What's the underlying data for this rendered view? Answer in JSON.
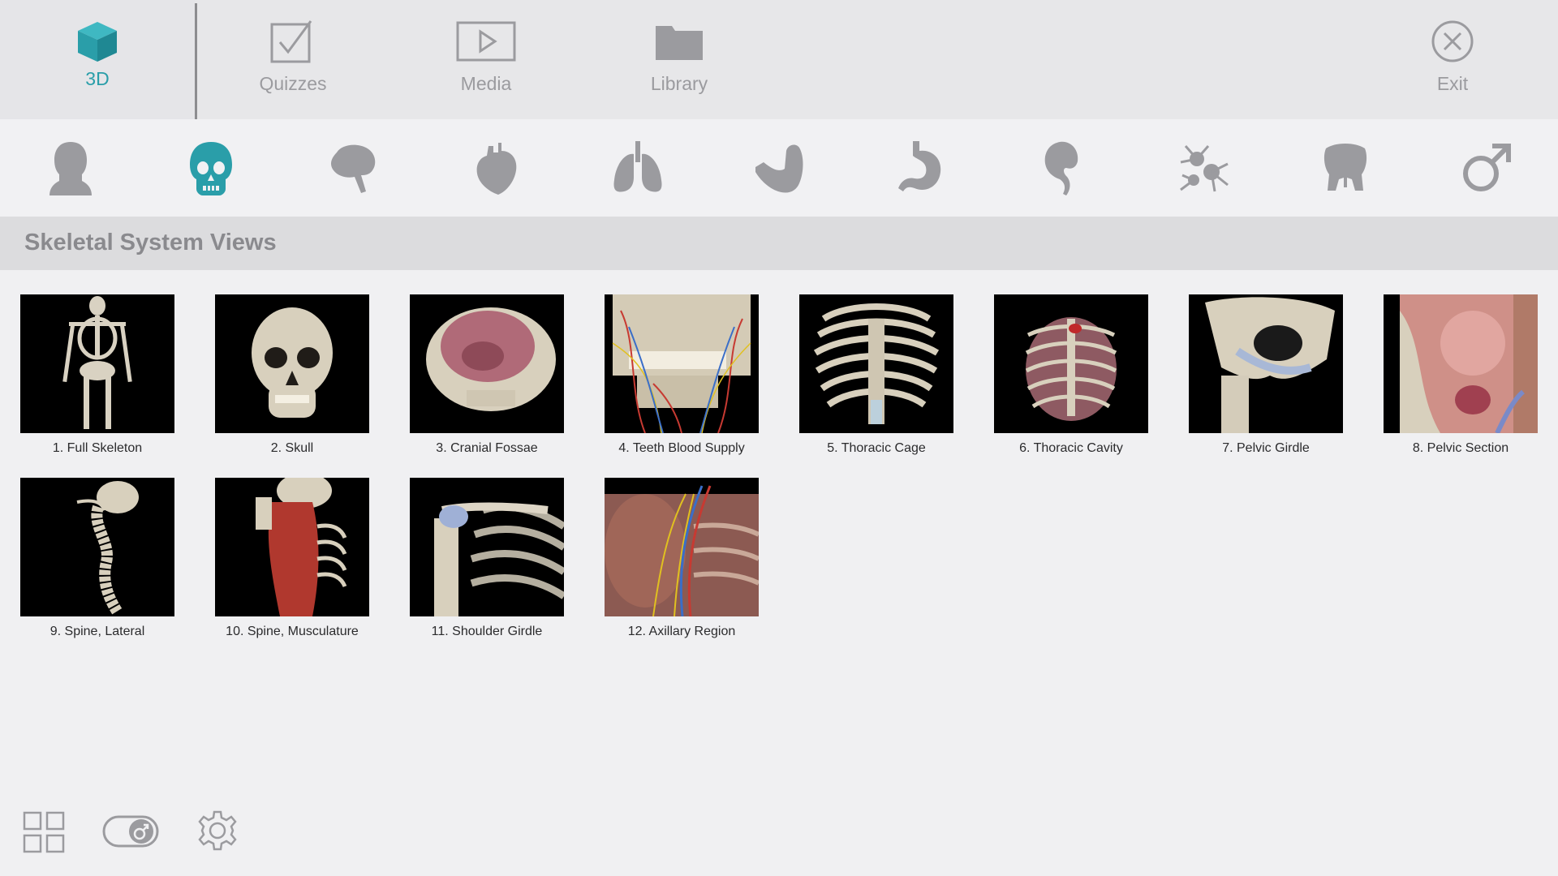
{
  "nav": {
    "tab_3d": {
      "label": "3D",
      "icon": "cube-icon"
    },
    "tab_quizzes": {
      "label": "Quizzes",
      "icon": "checkbox-icon"
    },
    "tab_media": {
      "label": "Media",
      "icon": "play-icon"
    },
    "tab_library": {
      "label": "Library",
      "icon": "folder-icon"
    },
    "tab_exit": {
      "label": "Exit",
      "icon": "close-circle-icon"
    }
  },
  "systems": [
    {
      "icon": "head-silhouette-icon",
      "selected": false
    },
    {
      "icon": "skull-icon",
      "selected": true
    },
    {
      "icon": "brain-icon",
      "selected": false
    },
    {
      "icon": "heart-icon",
      "selected": false
    },
    {
      "icon": "lungs-icon",
      "selected": false
    },
    {
      "icon": "muscle-arm-icon",
      "selected": false
    },
    {
      "icon": "stomach-icon",
      "selected": false
    },
    {
      "icon": "kidney-icon",
      "selected": false
    },
    {
      "icon": "immune-cells-icon",
      "selected": false
    },
    {
      "icon": "pelvis-icon",
      "selected": false
    },
    {
      "icon": "male-symbol-icon",
      "selected": false
    }
  ],
  "section": {
    "title": "Skeletal System Views"
  },
  "views": [
    {
      "label": "1. Full Skeleton"
    },
    {
      "label": "2. Skull"
    },
    {
      "label": "3. Cranial Fossae"
    },
    {
      "label": "4. Teeth Blood Supply"
    },
    {
      "label": "5. Thoracic Cage"
    },
    {
      "label": "6. Thoracic Cavity"
    },
    {
      "label": "7. Pelvic Girdle"
    },
    {
      "label": "8. Pelvic Section"
    },
    {
      "label": "9. Spine, Lateral"
    },
    {
      "label": "10. Spine, Musculature"
    },
    {
      "label": "11. Shoulder Girdle"
    },
    {
      "label": "12. Axillary Region"
    }
  ],
  "toolbar": {
    "grid_icon": "grid-view-icon",
    "toggle_icon": "gender-toggle-icon",
    "settings_icon": "gear-icon"
  },
  "colors": {
    "accent": "#2a9ea9",
    "icon_gray": "#9b9b9f",
    "bone": "#d9d2c2"
  }
}
